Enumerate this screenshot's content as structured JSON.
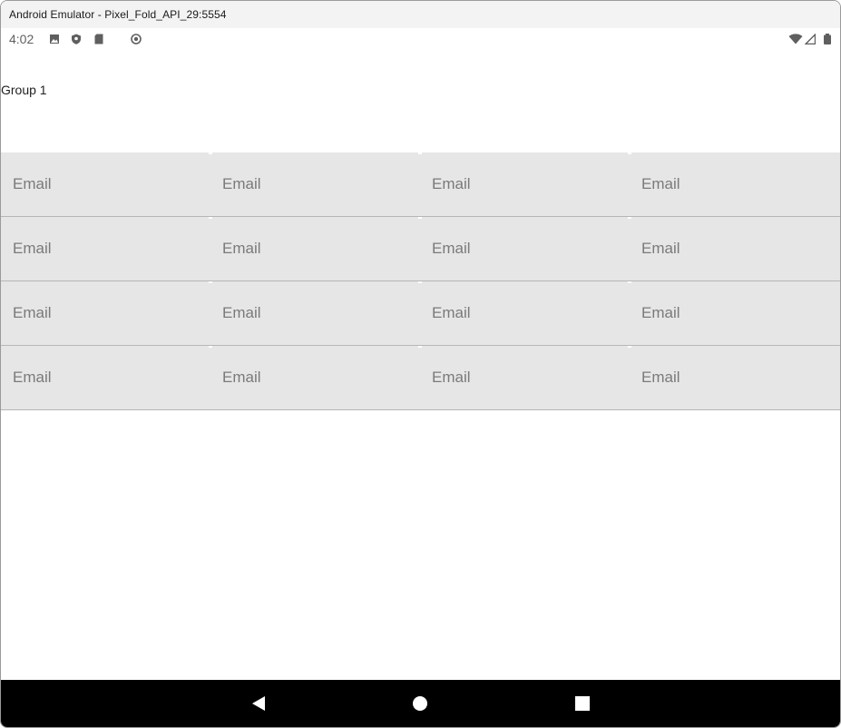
{
  "window": {
    "title": "Android Emulator - Pixel_Fold_API_29:5554"
  },
  "statusbar": {
    "time": "4:02",
    "left_icons": [
      "image-icon",
      "shield-icon",
      "sd-card-icon",
      "circle-target-icon"
    ],
    "right_icons": [
      "wifi-icon",
      "signal-icon",
      "battery-icon"
    ]
  },
  "content": {
    "group_label": "Group 1",
    "rows": [
      [
        "Email",
        "Email",
        "Email",
        "Email"
      ],
      [
        "Email",
        "Email",
        "Email",
        "Email"
      ],
      [
        "Email",
        "Email",
        "Email",
        "Email"
      ],
      [
        "Email",
        "Email",
        "Email",
        "Email"
      ]
    ]
  },
  "navbar": {
    "buttons": [
      "back-icon",
      "home-icon",
      "recents-icon"
    ]
  },
  "colors": {
    "field_background": "#e6e6e6",
    "field_text": "#7a7a7a",
    "navbar": "#000000"
  }
}
